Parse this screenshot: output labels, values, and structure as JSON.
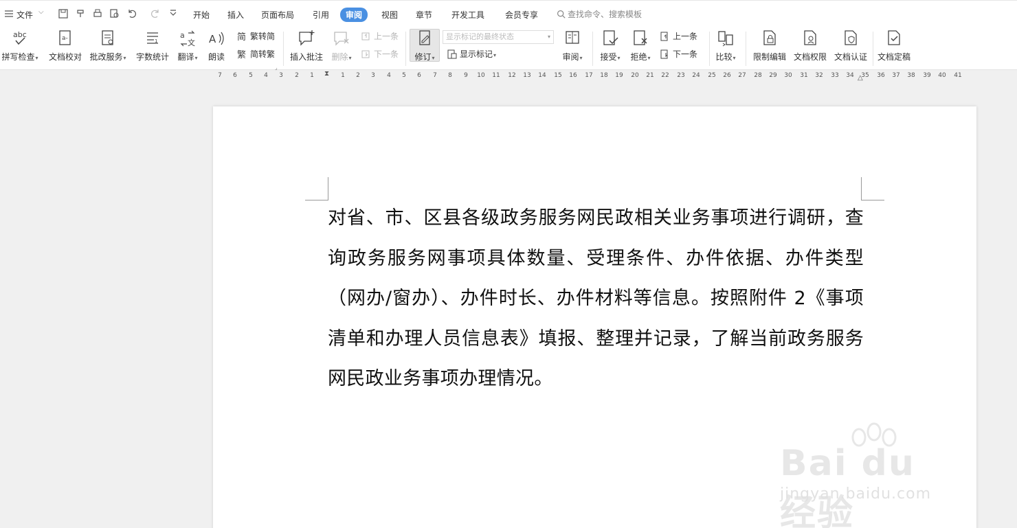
{
  "menubar": {
    "file_label": "文件",
    "tabs": [
      "开始",
      "插入",
      "页面布局",
      "引用",
      "审阅",
      "视图",
      "章节",
      "开发工具",
      "会员专享"
    ],
    "active_tab": "审阅",
    "search_placeholder": "查找命令、搜索模板"
  },
  "ribbon": {
    "spell_check": "拼写检查",
    "doc_proofread": "文档校对",
    "revise_service": "批改服务",
    "word_count": "字数统计",
    "translate": "翻译",
    "read_aloud": "朗读",
    "trad_to_simp": "繁转简",
    "simp_to_trad": "简转繁",
    "insert_comment": "插入批注",
    "delete": "删除",
    "prev_comment": "上一条",
    "next_comment": "下一条",
    "track_changes": "修订",
    "markup_state": "显示标记的最终状态",
    "show_markup": "显示标记",
    "review_pane": "审阅",
    "accept": "接受",
    "reject": "拒绝",
    "prev_change": "上一条",
    "next_change": "下一条",
    "compare": "比较",
    "restrict_edit": "限制编辑",
    "doc_permission": "文档权限",
    "doc_certify": "文档认证",
    "doc_finalize": "文档定稿"
  },
  "ruler": {
    "left": [
      "7",
      "6",
      "5",
      "4",
      "3",
      "2",
      "1"
    ],
    "right": [
      "1",
      "2",
      "3",
      "4",
      "5",
      "6",
      "7",
      "8",
      "9",
      "10",
      "11",
      "12",
      "13",
      "14",
      "15",
      "16",
      "17",
      "18",
      "19",
      "20",
      "21",
      "22",
      "23",
      "24",
      "25",
      "26",
      "27",
      "28",
      "29",
      "30",
      "31",
      "32",
      "33",
      "34",
      "35",
      "36",
      "37",
      "38",
      "39",
      "40",
      "41"
    ]
  },
  "document": {
    "paragraph": "对省、市、区县各级政务服务网民政相关业务事项进行调研，查询政务服务网事项具体数量、受理条件、办件依据、办件类型（网办/窗办）、办件时长、办件材料等信息。按照附件 2《事项清单和办理人员信息表》填报、整理并记录，了解当前政务服务网民政业务事项办理情况。"
  },
  "watermark": {
    "logo": "Bai du 经验",
    "url": "jingyan.baidu.com"
  }
}
